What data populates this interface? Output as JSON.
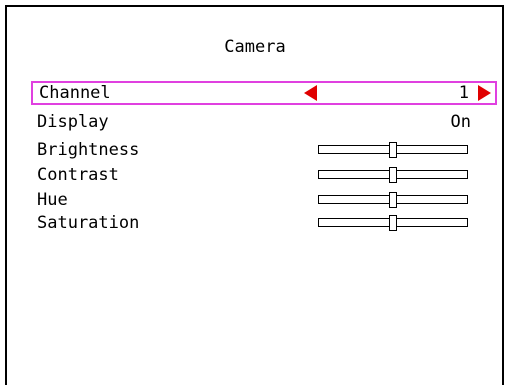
{
  "title": "Camera",
  "rows": {
    "channel": {
      "label": "Channel",
      "value": "1"
    },
    "display": {
      "label": "Display",
      "value": "On"
    },
    "brightness": {
      "label": "Brightness",
      "level": 0.5
    },
    "contrast": {
      "label": "Contrast",
      "level": 0.5
    },
    "hue": {
      "label": "Hue",
      "level": 0.5
    },
    "saturation": {
      "label": "Saturation",
      "level": 0.5
    }
  },
  "colors": {
    "highlight": "#e040e0",
    "arrow": "#e00000"
  }
}
